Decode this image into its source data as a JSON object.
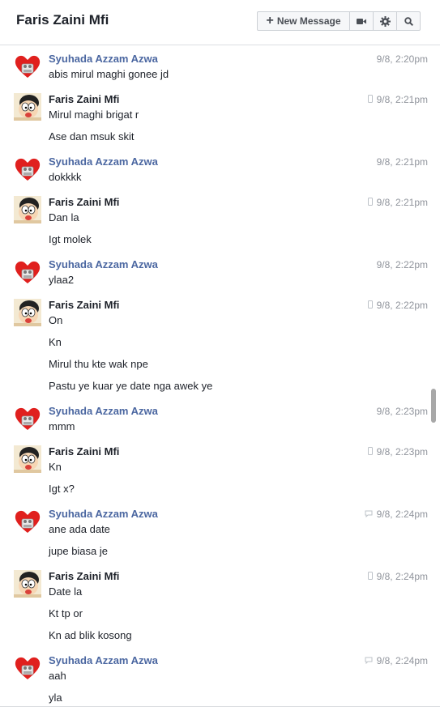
{
  "header": {
    "title": "Faris Zaini Mfi",
    "new_message_label": "New Message",
    "icons": [
      "plus-icon",
      "video-call-icon",
      "settings-gear-icon",
      "search-icon"
    ]
  },
  "colors": {
    "sender_link": "#4b67a1",
    "timestamp": "#90949c",
    "text": "#1d2129"
  },
  "messages": [
    {
      "sender": "Syuhada Azzam Azwa",
      "avatar": "heart-avatar",
      "time": "9/8, 2:20pm",
      "device": "",
      "lines": [
        "abis mirul maghi gonee jd"
      ]
    },
    {
      "sender": "Faris Zaini Mfi",
      "avatar": "cartoon-avatar",
      "time": "9/8, 2:21pm",
      "device": "mobile",
      "lines": [
        "Mirul maghi brigat r",
        "Ase dan msuk skit"
      ]
    },
    {
      "sender": "Syuhada Azzam Azwa",
      "avatar": "heart-avatar",
      "time": "9/8, 2:21pm",
      "device": "",
      "lines": [
        "dokkkk"
      ]
    },
    {
      "sender": "Faris Zaini Mfi",
      "avatar": "cartoon-avatar",
      "time": "9/8, 2:21pm",
      "device": "mobile",
      "lines": [
        "Dan la",
        "Igt molek"
      ]
    },
    {
      "sender": "Syuhada Azzam Azwa",
      "avatar": "heart-avatar",
      "time": "9/8, 2:22pm",
      "device": "",
      "lines": [
        "ylaa2"
      ]
    },
    {
      "sender": "Faris Zaini Mfi",
      "avatar": "cartoon-avatar",
      "time": "9/8, 2:22pm",
      "device": "mobile",
      "lines": [
        "On",
        "Kn",
        "Mirul thu kte wak npe",
        "Pastu ye kuar ye date nga awek ye"
      ]
    },
    {
      "sender": "Syuhada Azzam Azwa",
      "avatar": "heart-avatar",
      "time": "9/8, 2:23pm",
      "device": "",
      "lines": [
        "mmm"
      ]
    },
    {
      "sender": "Faris Zaini Mfi",
      "avatar": "cartoon-avatar",
      "time": "9/8, 2:23pm",
      "device": "mobile",
      "lines": [
        "Kn",
        "Igt x?"
      ]
    },
    {
      "sender": "Syuhada Azzam Azwa",
      "avatar": "heart-avatar",
      "time": "9/8, 2:24pm",
      "device": "chat",
      "lines": [
        "ane ada date",
        "jupe biasa je"
      ]
    },
    {
      "sender": "Faris Zaini Mfi",
      "avatar": "cartoon-avatar",
      "time": "9/8, 2:24pm",
      "device": "mobile",
      "lines": [
        "Date la",
        "Kt tp or",
        "Kn ad blik kosong"
      ]
    },
    {
      "sender": "Syuhada Azzam Azwa",
      "avatar": "heart-avatar",
      "time": "9/8, 2:24pm",
      "device": "chat",
      "lines": [
        "aah",
        "yla"
      ]
    }
  ]
}
